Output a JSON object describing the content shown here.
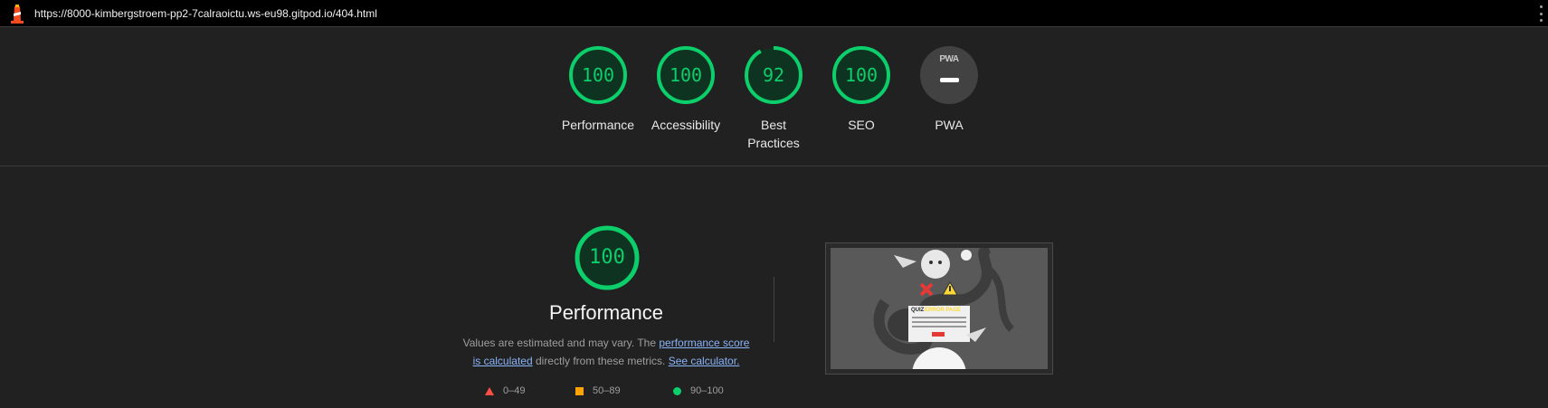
{
  "browser": {
    "url": "https://8000-kimbergstroem-pp2-7calraoictu.ws-eu98.gitpod.io/404.html"
  },
  "scores": [
    {
      "label": "Performance",
      "value": "100",
      "progress": 1.0
    },
    {
      "label": "Accessibility",
      "value": "100",
      "progress": 1.0
    },
    {
      "label": "Best Practices",
      "value": "92",
      "progress": 0.92
    },
    {
      "label": "SEO",
      "value": "100",
      "progress": 1.0
    },
    {
      "label": "PWA",
      "badge": "PWA"
    }
  ],
  "performance_section": {
    "score": "100",
    "title": "Performance",
    "desc_pre": "Values are estimated and may vary. The ",
    "desc_link1": "performance score is calculated",
    "desc_mid": " directly from these metrics. ",
    "desc_link2": "See calculator.",
    "legend": [
      {
        "range": "0–49",
        "shape": "triangle",
        "color": "#ff4e42"
      },
      {
        "range": "50–89",
        "shape": "square",
        "color": "#ffa400"
      },
      {
        "range": "90–100",
        "shape": "circle",
        "color": "#0cce6b"
      }
    ]
  },
  "thumbnail": {
    "logo_left": "QUIZ",
    "logo_right": "ERROR PAGE"
  },
  "colors": {
    "pass": "#0cce6b",
    "average": "#ffa400",
    "fail": "#ff4e42",
    "background": "#212121",
    "link": "#8ab4f8"
  }
}
